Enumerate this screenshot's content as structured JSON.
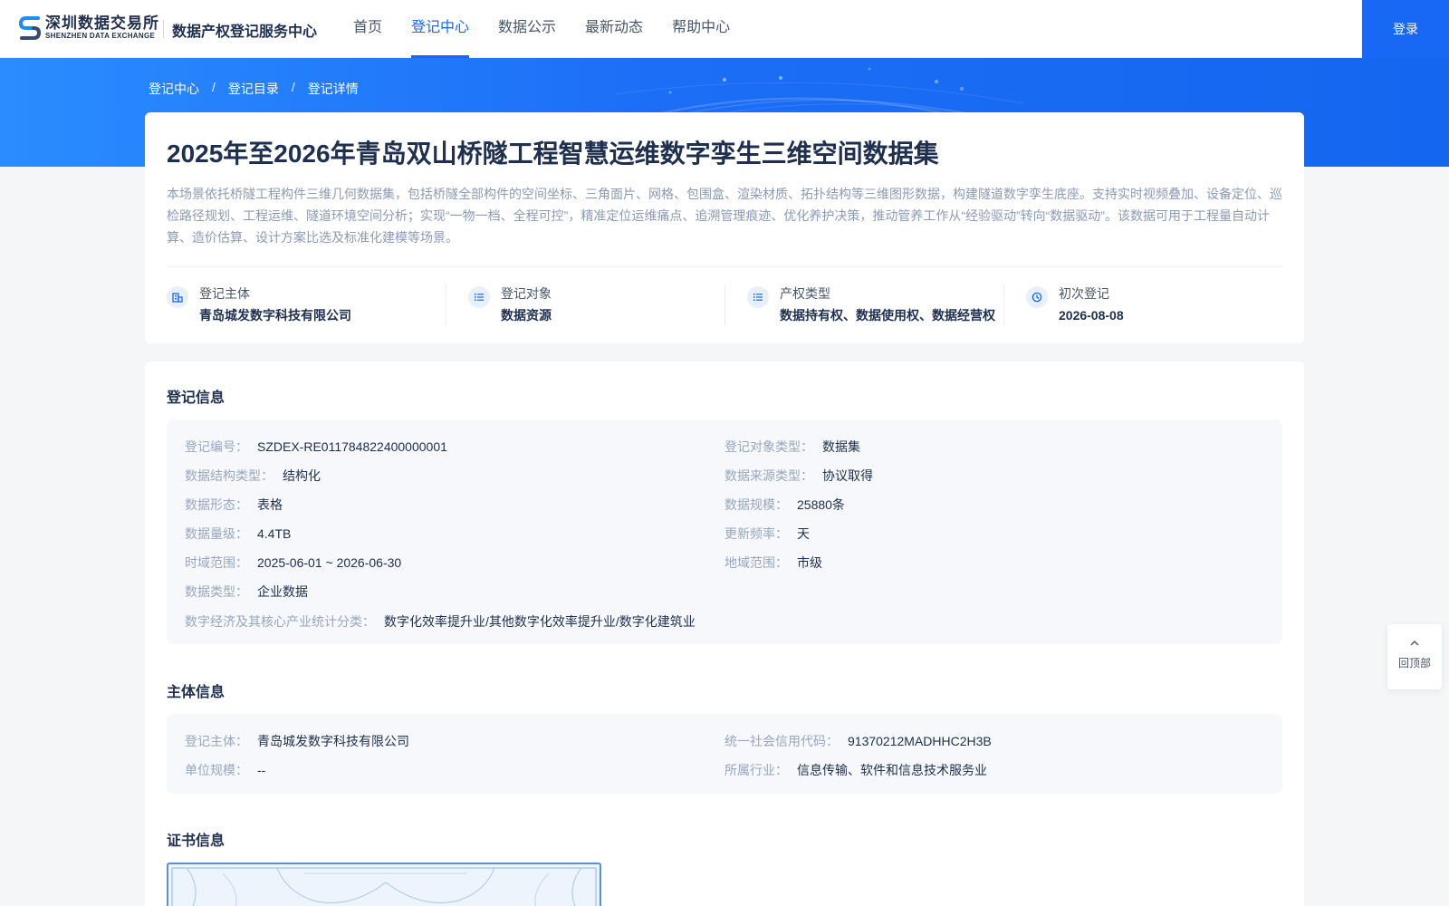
{
  "header": {
    "logo_cn": "深圳数据交易所",
    "logo_en": "SHENZHEN DATA EXCHANGE",
    "site_title": "数据产权登记服务中心",
    "nav": [
      {
        "label": "首页"
      },
      {
        "label": "登记中心"
      },
      {
        "label": "数据公示"
      },
      {
        "label": "最新动态"
      },
      {
        "label": "帮助中心"
      }
    ],
    "login_label": "登录"
  },
  "breadcrumb": [
    "登记中心",
    "登记目录",
    "登记详情"
  ],
  "breadcrumb_sep": "/",
  "dataset": {
    "title": "2025年至2026年青岛双山桥隧工程智慧运维数字孪生三维空间数据集",
    "description": "本场景依托桥隧工程构件三维几何数据集，包括桥隧全部构件的空间坐标、三角面片、网格、包围盒、渲染材质、拓扑结构等三维图形数据，构建隧道数字孪生底座。支持实时视频叠加、设备定位、巡检路径规划、工程运维、隧道环境空间分析；实现“一物一档、全程可控”，精准定位运维痛点、追溯管理痕迹、优化养护决策，推动管养工作从“经验驱动”转向“数据驱动”。该数据可用于工程量自动计算、造价估算、设计方案比选及标准化建模等场景。",
    "meta": [
      {
        "icon": "building-icon",
        "label": "登记主体",
        "value": "青岛城发数字科技有限公司"
      },
      {
        "icon": "list-icon",
        "label": "登记对象",
        "value": "数据资源"
      },
      {
        "icon": "list-icon",
        "label": "产权类型",
        "value": "数据持有权、数据使用权、数据经营权"
      },
      {
        "icon": "clock-icon",
        "label": "初次登记",
        "value": "2026-08-08"
      }
    ]
  },
  "registration_info": {
    "title": "登记信息",
    "left": [
      {
        "key": "登记编号：",
        "value": "SZDEX-RE011784822400000001"
      },
      {
        "key": "数据结构类型：",
        "value": "结构化"
      },
      {
        "key": "数据形态：",
        "value": "表格"
      },
      {
        "key": "数据量级：",
        "value": "4.4TB"
      },
      {
        "key": "时域范围：",
        "value": "2025-06-01 ~ 2026-06-30"
      },
      {
        "key": "数据类型：",
        "value": "企业数据"
      }
    ],
    "right": [
      {
        "key": "登记对象类型：",
        "value": "数据集"
      },
      {
        "key": "数据来源类型：",
        "value": "协议取得"
      },
      {
        "key": "数据规模：",
        "value": "25880条"
      },
      {
        "key": "更新频率：",
        "value": "天"
      },
      {
        "key": "地域范围：",
        "value": "市级"
      }
    ],
    "full": {
      "key": "数字经济及其核心产业统计分类：",
      "value": "数字化效率提升业/其他数字化效率提升业/数字化建筑业"
    }
  },
  "subject_info": {
    "title": "主体信息",
    "left": [
      {
        "key": "登记主体：",
        "value": "青岛城发数字科技有限公司"
      },
      {
        "key": "单位规模：",
        "value": "--"
      }
    ],
    "right": [
      {
        "key": "统一社会信用代码：",
        "value": "91370212MADHHC2H3B"
      },
      {
        "key": "所属行业：",
        "value": "信息传输、软件和信息技术服务业"
      }
    ]
  },
  "certificate_info": {
    "title": "证书信息"
  },
  "back_to_top": {
    "label": "回顶部"
  },
  "colors": {
    "primary": "#1967f5",
    "title": "#1f2f4f",
    "muted": "#9aa6bd"
  }
}
